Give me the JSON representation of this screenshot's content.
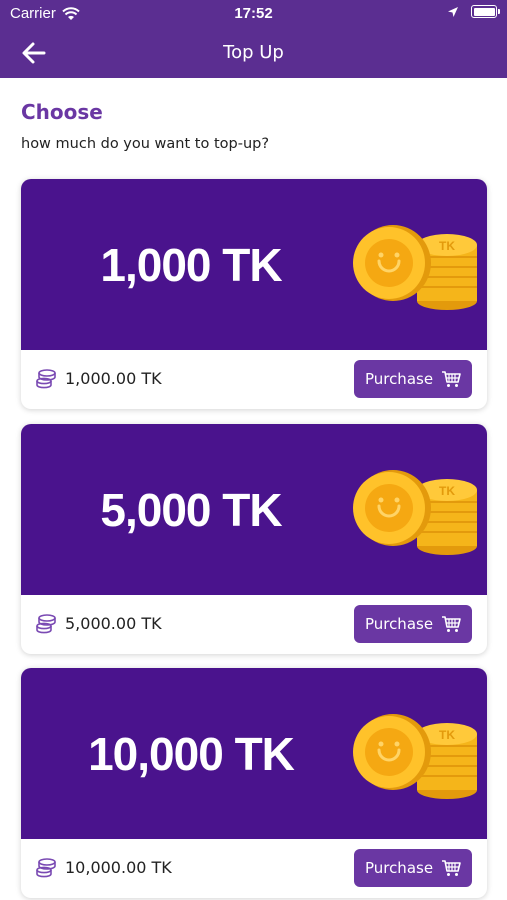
{
  "status_bar": {
    "carrier": "Carrier",
    "time": "17:52"
  },
  "nav": {
    "title": "Top Up"
  },
  "heading": "Choose",
  "subheading": "how much do you want to top-up?",
  "colors": {
    "brand": "#5b2e91",
    "banner": "#4a138d",
    "button": "#6a37a3",
    "coin": "#f5b51a"
  },
  "cards": [
    {
      "banner_text": "1,000 TK",
      "amount": "1,000.00 TK",
      "button_label": "Purchase",
      "coin_label": "TK"
    },
    {
      "banner_text": "5,000 TK",
      "amount": "5,000.00 TK",
      "button_label": "Purchase",
      "coin_label": "TK"
    },
    {
      "banner_text": "10,000 TK",
      "amount": "10,000.00 TK",
      "button_label": "Purchase",
      "coin_label": "TK"
    }
  ]
}
